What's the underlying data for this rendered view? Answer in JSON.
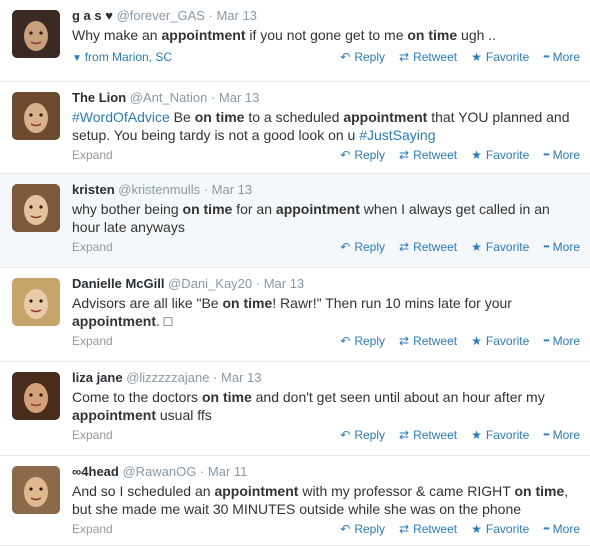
{
  "actions": {
    "reply": "Reply",
    "retweet": "Retweet",
    "favorite": "Favorite",
    "more": "More",
    "expand": "Expand"
  },
  "icons": {
    "reply": "reply-arrow-icon",
    "retweet": "retweet-icon",
    "favorite": "star-icon",
    "more": "dots-icon",
    "location": "location-pin-icon"
  },
  "tweets": [
    {
      "fullname": "g a s ♥",
      "username": "@forever_GAS",
      "time": "Mar 13",
      "parts": [
        [
          "Why make an ",
          ""
        ],
        [
          "appointment",
          "b"
        ],
        [
          " if you not gone get to me ",
          ""
        ],
        [
          "on time",
          "b"
        ],
        [
          " ugh ..",
          ""
        ]
      ],
      "location": "from Marion, SC"
    },
    {
      "fullname": "The Lion",
      "username": "@Ant_Nation",
      "time": "Mar 13",
      "parts": [
        [
          "#WordOfAdvice",
          "tag"
        ],
        [
          " Be ",
          ""
        ],
        [
          "on time",
          "b"
        ],
        [
          " to a scheduled ",
          ""
        ],
        [
          "appointment",
          "b"
        ],
        [
          " that YOU planned and setup. You being tardy is not a good look on u ",
          ""
        ],
        [
          "#JustSaying",
          "tag"
        ]
      ]
    },
    {
      "fullname": "kristen",
      "username": "@kristenmulls",
      "time": "Mar 13",
      "parts": [
        [
          "why bother being ",
          ""
        ],
        [
          "on time",
          "b"
        ],
        [
          " for an ",
          ""
        ],
        [
          "appointment",
          "b"
        ],
        [
          " when I always get called in an hour late anyways",
          ""
        ]
      ]
    },
    {
      "fullname": "Danielle McGill",
      "username": "@Dani_Kay20",
      "time": "Mar 13",
      "parts": [
        [
          "Advisors are all like \"Be ",
          ""
        ],
        [
          "on time",
          "b"
        ],
        [
          "! Rawr!\" Then run 10 mins late for your ",
          ""
        ],
        [
          "appointment",
          "b"
        ],
        [
          ". □",
          ""
        ]
      ]
    },
    {
      "fullname": "liza jane",
      "username": "@lizzzzzajane",
      "time": "Mar 13",
      "parts": [
        [
          "Come to the doctors ",
          ""
        ],
        [
          "on time",
          "b"
        ],
        [
          " and don't get seen until about an hour after my ",
          ""
        ],
        [
          "appointment",
          "b"
        ],
        [
          " usual ffs",
          ""
        ]
      ]
    },
    {
      "fullname": "∞4head",
      "username": "@RawanOG",
      "time": "Mar 11",
      "parts": [
        [
          "And so I scheduled an ",
          ""
        ],
        [
          "appointment",
          "b"
        ],
        [
          " with my professor & came RIGHT ",
          ""
        ],
        [
          "on time",
          "b"
        ],
        [
          ", but she made me wait 30 MINUTES outside while she was on the phone",
          ""
        ]
      ]
    }
  ]
}
